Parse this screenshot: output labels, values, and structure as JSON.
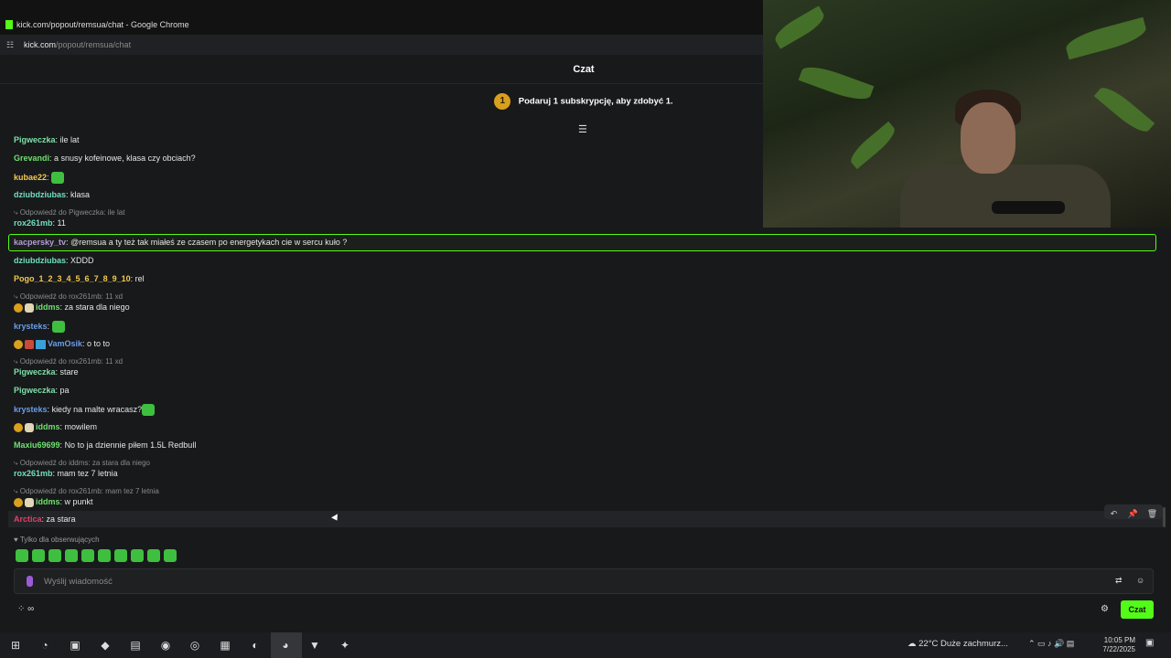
{
  "window": {
    "title": "kick.com/popout/remsua/chat - Google Chrome"
  },
  "address_bar": {
    "domain": "kick.com",
    "path": "/popout/remsua/chat"
  },
  "chat": {
    "title": "Czat",
    "promo_badge": "1",
    "promo_text": "Podaruj 1 subskrypcję, aby zdobyć 1.",
    "colors": {
      "accent": "#53fc18",
      "highlight_border": "#53fc18"
    },
    "messages": [
      {
        "user": "Pigweczka",
        "color": "#7ee0a8",
        "text": "ile lat"
      },
      {
        "user": "Grevandi",
        "color": "#6ee06e",
        "text": "a snusy kofeinowe, klasa czy obciach?"
      },
      {
        "user": "kubae22",
        "color": "#f2c94c",
        "text": ""
      },
      {
        "user": "dziubdziubas",
        "color": "#6ee0c0",
        "text": "klasa"
      },
      {
        "reply": "Odpowiedź do Pigweczka: ile lat"
      },
      {
        "user": "rox261mb",
        "color": "#6ee0c0",
        "text": "11"
      },
      {
        "user": "kacpersky_tv",
        "color": "#b39ddb",
        "text": "@remsua a ty też tak miałeś ze czasem po energetykach cie w sercu kuło ?"
      },
      {
        "user": "dziubdziubas",
        "color": "#6ee0c0",
        "text": "XDDD"
      },
      {
        "user": "Pogo_1_2_3_4_5_6_7_8_9_10",
        "color": "#f2c94c",
        "text": "rel"
      },
      {
        "reply": "Odpowiedź do rox261mb: 11 xd"
      },
      {
        "user": "iddms",
        "color": "#6ee06e",
        "text": "za stara dla niego"
      },
      {
        "user": "krysteks",
        "color": "#6b9ee8",
        "text": ""
      },
      {
        "user": "VamOsik",
        "color": "#6b9ee8",
        "text": "o to to"
      },
      {
        "reply": "Odpowiedź do rox261mb: 11 xd"
      },
      {
        "user": "Pigweczka",
        "color": "#7ee0a8",
        "text": "stare"
      },
      {
        "user": "Pigweczka",
        "color": "#7ee0a8",
        "text": "pa"
      },
      {
        "user": "krysteks",
        "color": "#6b9ee8",
        "text": "kiedy na malte wracasz?"
      },
      {
        "user": "iddms",
        "color": "#6ee06e",
        "text": "mowilem"
      },
      {
        "user": "Maxiu69699",
        "color": "#6ee06e",
        "text": "No to ja dziennie piłem 1.5L Redbull"
      },
      {
        "reply": "Odpowiedź do iddms: za stara dla niego"
      },
      {
        "user": "rox261mb",
        "color": "#6ee0c0",
        "text": "mam tez 7 letnia"
      },
      {
        "reply": "Odpowiedź do rox261mb: mam tez 7 letnia"
      },
      {
        "user": "iddms",
        "color": "#6ee06e",
        "text": "w punkt"
      },
      {
        "user": "Arctica",
        "color": "#e0406a",
        "text": "za stara"
      }
    ],
    "followers_only": "Tylko dla obserwujących",
    "input_placeholder": "Wyślij wiadomość",
    "send_label": "Czat"
  },
  "taskbar": {
    "weather": "22°C  Duże zachmurz...",
    "time": "10:05 PM",
    "date": "7/22/2025"
  }
}
